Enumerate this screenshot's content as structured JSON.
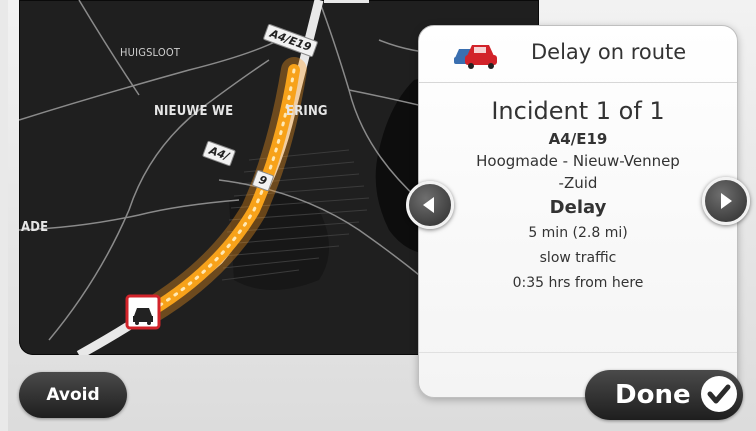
{
  "map": {
    "place_labels": [
      "HUIGSLOOT",
      "NIEUWE WE",
      "ERING",
      "ADE"
    ],
    "road_shields": [
      "A4/E19",
      "A4/",
      "9"
    ]
  },
  "incident_panel": {
    "header_title": "Delay on route",
    "header_icon": "car-icon",
    "title": "Incident 1 of 1",
    "road": "A4/E19",
    "description_line1": "Hoogmade - Nieuw-Vennep",
    "description_line2": "-Zuid",
    "type": "Delay",
    "delay": "5 min (2.8 mi)",
    "traffic": "slow traffic",
    "time_from_here": "0:35 hrs from here"
  },
  "buttons": {
    "avoid": "Avoid",
    "done": "Done",
    "prev_icon": "chevron-left-icon",
    "next_icon": "chevron-right-icon",
    "done_icon": "checkmark-icon"
  },
  "colors": {
    "route_orange": "#f7a21a",
    "incident_red": "#d2232a",
    "map_background": "#1f1f1f"
  }
}
